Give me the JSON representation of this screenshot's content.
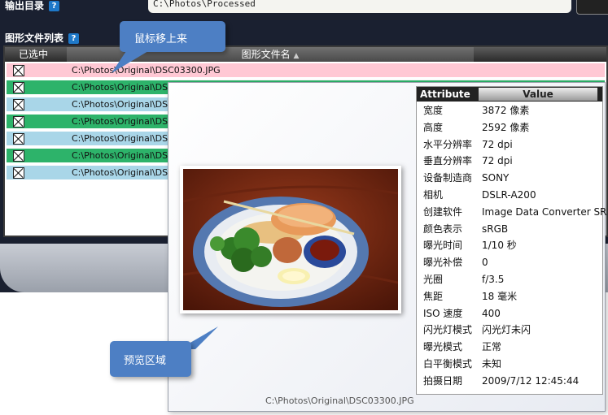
{
  "output_dir": {
    "label": "输出目录",
    "help": "?",
    "path": "C:\\Photos\\Processed"
  },
  "file_list": {
    "label": "图形文件列表",
    "help": "?",
    "columns": {
      "checked": "已选中",
      "filename": "图形文件名"
    },
    "rows": [
      {
        "file": "C:\\Photos\\Original\\DSC03300.JPG",
        "state": "hover"
      },
      {
        "file": "C:\\Photos\\Original\\DSC",
        "state": "green"
      },
      {
        "file": "C:\\Photos\\Original\\DSC",
        "state": "blue"
      },
      {
        "file": "C:\\Photos\\Original\\DSC",
        "state": "green"
      },
      {
        "file": "C:\\Photos\\Original\\DSC",
        "state": "blue"
      },
      {
        "file": "C:\\Photos\\Original\\DSC",
        "state": "green"
      },
      {
        "file": "C:\\Photos\\Original\\DSC",
        "state": "blue"
      }
    ]
  },
  "callouts": {
    "hover": "鼠标移上来",
    "preview": "预览区域"
  },
  "preview": {
    "caption": "C:\\Photos\\Original\\DSC03300.JPG"
  },
  "attributes": {
    "header": {
      "attribute": "Attribute",
      "value": "Value"
    },
    "rows": [
      {
        "key": "宽度",
        "value": "3872 像素"
      },
      {
        "key": "高度",
        "value": "2592 像素"
      },
      {
        "key": "水平分辨率",
        "value": "72 dpi"
      },
      {
        "key": "垂直分辨率",
        "value": "72 dpi"
      },
      {
        "key": "设备制造商",
        "value": "SONY"
      },
      {
        "key": "相机",
        "value": "DSLR-A200"
      },
      {
        "key": "创建软件",
        "value": "Image Data Converter SR"
      },
      {
        "key": "颜色表示",
        "value": "sRGB"
      },
      {
        "key": "曝光时间",
        "value": "1/10 秒"
      },
      {
        "key": "曝光补偿",
        "value": "0"
      },
      {
        "key": "光圈",
        "value": "f/3.5"
      },
      {
        "key": "焦距",
        "value": "18 毫米"
      },
      {
        "key": "ISO 速度",
        "value": "400"
      },
      {
        "key": "闪光灯模式",
        "value": "闪光灯未闪"
      },
      {
        "key": "曝光模式",
        "value": "正常"
      },
      {
        "key": "白平衡模式",
        "value": "未知"
      },
      {
        "key": "拍摄日期",
        "value": "2009/7/12 12:45:44"
      }
    ]
  },
  "colors": {
    "row_hover": "#ffc8d4",
    "row_green": "#2db36a",
    "row_blue": "#a9d6e8",
    "callout": "#4d7fc4"
  }
}
